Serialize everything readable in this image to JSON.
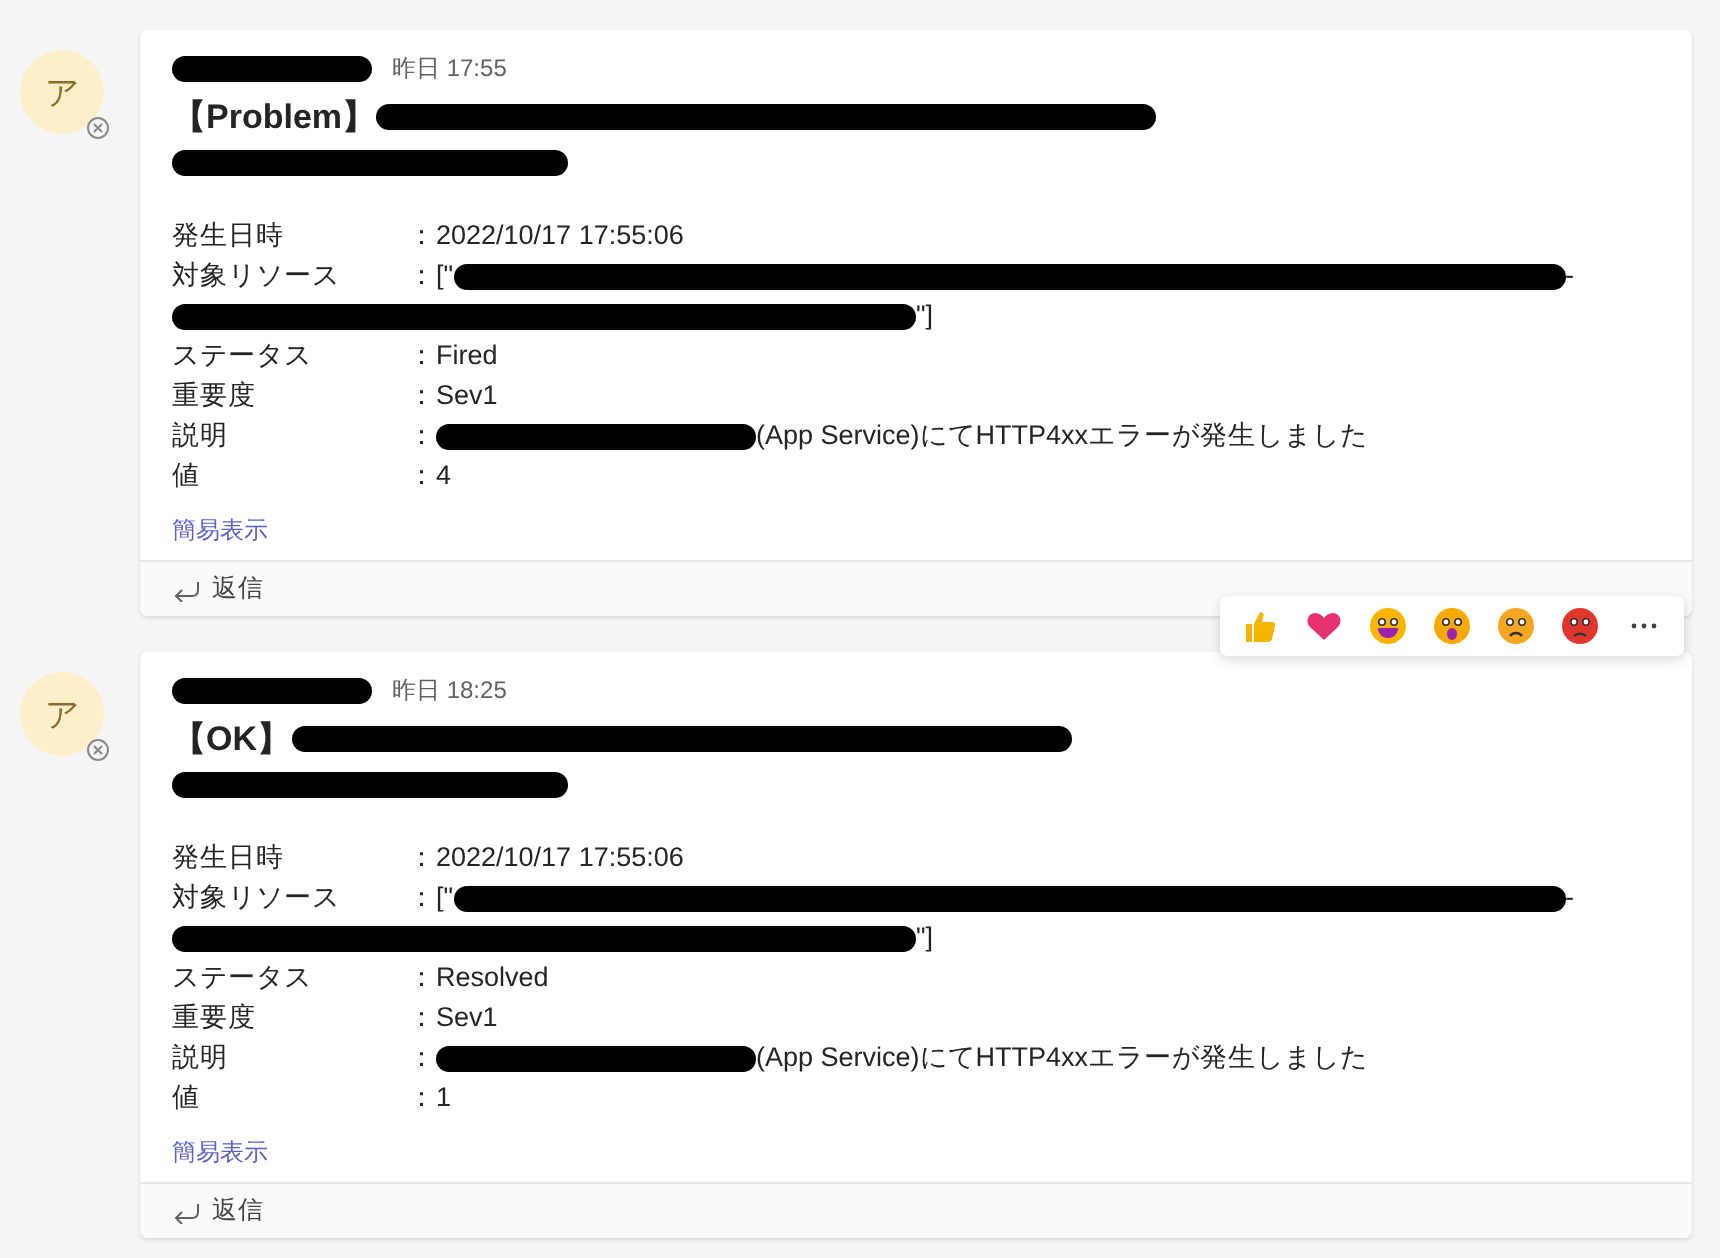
{
  "messages": [
    {
      "avatar": "ア",
      "time": "昨日 17:55",
      "title_prefix": "【Problem】",
      "fields": [
        {
          "kind": "plain",
          "label": "発生日時",
          "value": "：2022/10/17 17:55:06"
        },
        {
          "kind": "resource",
          "label": "対象リソース",
          "prefix": "：[\"",
          "line_end": "-",
          "suffix": "\"]"
        },
        {
          "kind": "plain",
          "label": "ステータス",
          "value": "：Fired"
        },
        {
          "kind": "plain",
          "label": "重要度",
          "value": "：Sev1"
        },
        {
          "kind": "description",
          "label": "説明",
          "prefix": "：",
          "value": "(App Service)にてHTTP4xxエラーが発生しました"
        },
        {
          "kind": "plain",
          "label": "値",
          "value": "：4"
        }
      ],
      "link": "簡易表示",
      "reply": "返信",
      "reactions": true
    },
    {
      "avatar": "ア",
      "time": "昨日 18:25",
      "title_prefix": "【OK】",
      "fields": [
        {
          "kind": "plain",
          "label": "発生日時",
          "value": "：2022/10/17 17:55:06"
        },
        {
          "kind": "resource",
          "label": "対象リソース",
          "prefix": "：[\"",
          "line_end": "-",
          "suffix": "\"]"
        },
        {
          "kind": "plain",
          "label": "ステータス",
          "value": "：Resolved"
        },
        {
          "kind": "plain",
          "label": "重要度",
          "value": "：Sev1"
        },
        {
          "kind": "description",
          "label": "説明",
          "prefix": "：",
          "value": "(App Service)にてHTTP4xxエラーが発生しました"
        },
        {
          "kind": "plain",
          "label": "値",
          "value": "：1"
        }
      ],
      "link": "簡易表示",
      "reply": "返信",
      "reactions": false
    }
  ]
}
